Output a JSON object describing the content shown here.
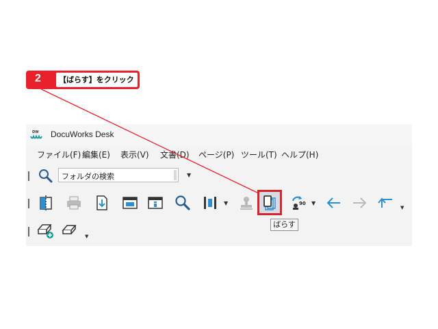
{
  "step": {
    "number": "2",
    "label": "【ばらす】をクリック"
  },
  "window": {
    "title": "DocuWorks Desk"
  },
  "menu": {
    "file": "ファイル(F)",
    "edit": "編集(E)",
    "view": "表示(V)",
    "document": "文書(D)",
    "page": "ページ(P)",
    "tools": "ツール(T)",
    "help": "ヘルプ(H)"
  },
  "search": {
    "value": "フォルダの検索"
  },
  "toolbar": {
    "tooltip": "ばらす",
    "rotate_degree": "90"
  },
  "colors": {
    "accent_red": "#e8212b",
    "icon_blue": "#2e8fd0",
    "icon_teal": "#1a9b9c"
  }
}
